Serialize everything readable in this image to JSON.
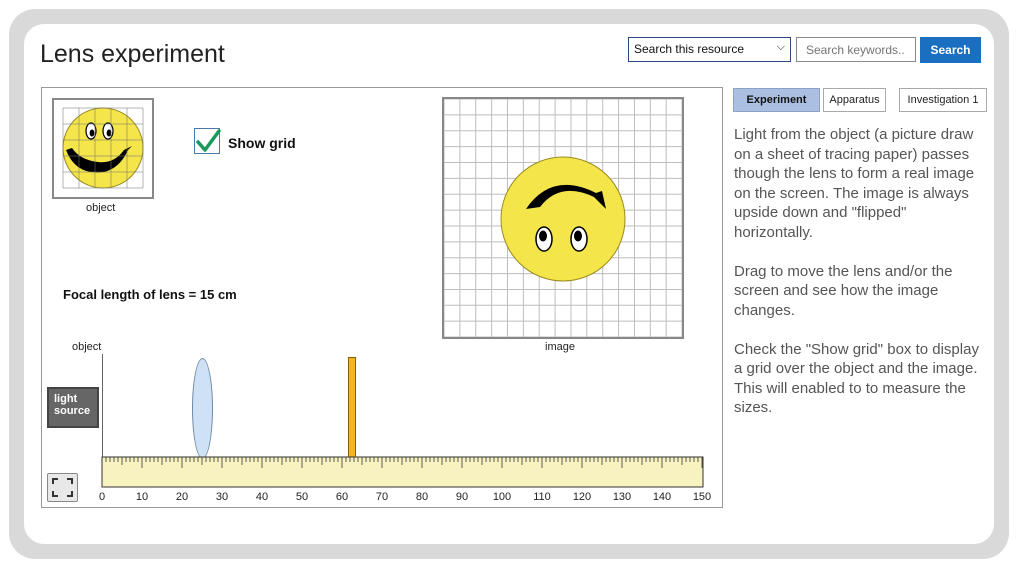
{
  "page": {
    "title": "Lens experiment"
  },
  "search": {
    "scope_value": "Search this resource",
    "placeholder": "Search keywords..",
    "button_label": "Search"
  },
  "experiment": {
    "object_caption": "object",
    "show_grid_label": "Show grid",
    "show_grid_checked": true,
    "focal_length_text": "Focal length of lens = 15 cm",
    "image_caption": "image",
    "bench_object_label": "object",
    "light_source_label_line1": "light",
    "light_source_label_line2": "source",
    "ruler": {
      "min": 0,
      "max": 150,
      "unit": "cm",
      "tick_labels": [
        "0",
        "10",
        "20",
        "30",
        "40",
        "50",
        "60",
        "70",
        "80",
        "90",
        "100",
        "110",
        "120",
        "130",
        "140",
        "150"
      ]
    },
    "lens_position_cm": 25,
    "screen_position_cm": 62.5
  },
  "tabs": [
    {
      "label": "Experiment",
      "active": true
    },
    {
      "label": "Apparatus",
      "active": false
    },
    {
      "label": "Investigation 1",
      "active": false
    }
  ],
  "description": [
    "Light from the object (a picture draw on a sheet of tracing paper) passes though the lens to form a real image on the screen. The image is always upside down and \"flipped\" horizontally.",
    "Drag to move the lens and/or the screen and see how the image changes.",
    "Check the \"Show grid\" box to display a grid over the object and the image. This will enabled to to measure the sizes."
  ],
  "colors": {
    "search_button": "#1a6fc0",
    "active_tab": "#aabfe2",
    "lens_fill": "#cfe2f5",
    "screen_fill": "#f4b722",
    "ruler_fill": "#f8f2c0",
    "smiley_fill": "#f4e54a"
  }
}
